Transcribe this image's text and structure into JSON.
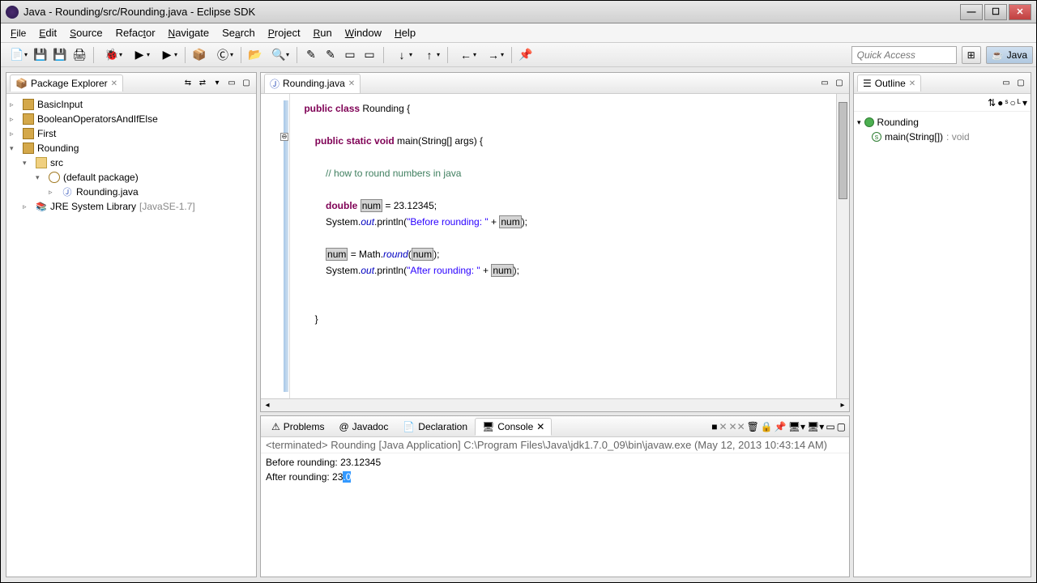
{
  "window": {
    "title": "Java - Rounding/src/Rounding.java - Eclipse SDK"
  },
  "menubar": [
    "File",
    "Edit",
    "Source",
    "Refactor",
    "Navigate",
    "Search",
    "Project",
    "Run",
    "Window",
    "Help"
  ],
  "toolbar": {
    "quick_access_placeholder": "Quick Access",
    "perspective_label": "Java"
  },
  "package_explorer": {
    "title": "Package Explorer",
    "projects": [
      {
        "name": "BasicInput",
        "expanded": false
      },
      {
        "name": "BooleanOperatorsAndIfElse",
        "expanded": false
      },
      {
        "name": "First",
        "expanded": false
      },
      {
        "name": "Rounding",
        "expanded": true,
        "src": {
          "name": "src",
          "default_package": "(default package)",
          "files": [
            "Rounding.java"
          ]
        },
        "jre": {
          "label": "JRE System Library",
          "version": "[JavaSE-1.7]"
        }
      }
    ]
  },
  "editor": {
    "tab_label": "Rounding.java",
    "code_tokens": [
      [
        {
          "t": "    ",
          "c": ""
        },
        {
          "t": "public class",
          "c": "kw"
        },
        {
          "t": " Rounding {",
          "c": ""
        }
      ],
      [
        {
          "t": "",
          "c": ""
        }
      ],
      [
        {
          "t": "        ",
          "c": ""
        },
        {
          "t": "public static void",
          "c": "kw"
        },
        {
          "t": " main(String[] args) {",
          "c": ""
        }
      ],
      [
        {
          "t": "",
          "c": ""
        }
      ],
      [
        {
          "t": "            ",
          "c": ""
        },
        {
          "t": "// how to round numbers in java",
          "c": "com"
        }
      ],
      [
        {
          "t": "",
          "c": ""
        }
      ],
      [
        {
          "t": "            ",
          "c": ""
        },
        {
          "t": "double",
          "c": "kw"
        },
        {
          "t": " ",
          "c": ""
        },
        {
          "t": "num",
          "c": "hl"
        },
        {
          "t": " = 23.12345;",
          "c": ""
        }
      ],
      [
        {
          "t": "            System.",
          "c": ""
        },
        {
          "t": "out",
          "c": "fld"
        },
        {
          "t": ".println(",
          "c": ""
        },
        {
          "t": "\"Before rounding: \"",
          "c": "str"
        },
        {
          "t": " + ",
          "c": ""
        },
        {
          "t": "num",
          "c": "hl"
        },
        {
          "t": ");",
          "c": ""
        }
      ],
      [
        {
          "t": "",
          "c": ""
        }
      ],
      [
        {
          "t": "            ",
          "c": ""
        },
        {
          "t": "num",
          "c": "hl"
        },
        {
          "t": " = Math.",
          "c": ""
        },
        {
          "t": "round",
          "c": "fld"
        },
        {
          "t": "(",
          "c": ""
        },
        {
          "t": "num",
          "c": "hl"
        },
        {
          "t": ");",
          "c": ""
        }
      ],
      [
        {
          "t": "            System.",
          "c": ""
        },
        {
          "t": "out",
          "c": "fld"
        },
        {
          "t": ".println(",
          "c": ""
        },
        {
          "t": "\"After rounding: \"",
          "c": "str"
        },
        {
          "t": " + ",
          "c": ""
        },
        {
          "t": "num",
          "c": "hl"
        },
        {
          "t": ");",
          "c": ""
        }
      ],
      [
        {
          "t": "",
          "c": ""
        }
      ],
      [
        {
          "t": "",
          "c": ""
        }
      ],
      [
        {
          "t": "        }",
          "c": ""
        }
      ]
    ]
  },
  "bottom": {
    "tabs": [
      "Problems",
      "Javadoc",
      "Declaration",
      "Console"
    ],
    "active_tab": "Console",
    "console_info": "<terminated> Rounding [Java Application] C:\\Program Files\\Java\\jdk1.7.0_09\\bin\\javaw.exe (May 12, 2013 10:43:14 AM)",
    "console_lines": [
      {
        "pre": "Before rounding: 23.12345",
        "sel": ""
      },
      {
        "pre": "After rounding: 23",
        "sel": ".0"
      }
    ]
  },
  "outline": {
    "title": "Outline",
    "class": "Rounding",
    "method": {
      "sig": "main(String[])",
      "ret": ": void"
    }
  }
}
